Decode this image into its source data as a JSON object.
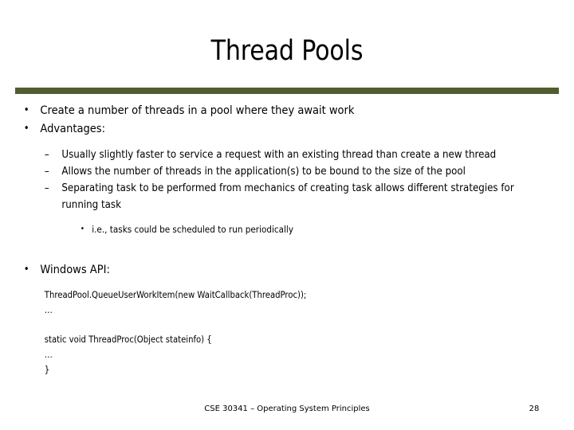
{
  "slide": {
    "title": "Thread Pools",
    "accent_color": "#4f5d2f",
    "background_color": "#ffffff",
    "text_color": "#000000"
  },
  "bullets": {
    "marker_level1": "•",
    "marker_level2": "–",
    "marker_level3": "•",
    "level1": [
      "Create a number of threads in a pool where they await work",
      "Advantages:"
    ],
    "level2": [
      "Usually slightly faster to service a request with an existing thread than create a new thread",
      "Allows the number of threads in the application(s) to be bound to the size of the pool",
      "Separating task to be performed from mechanics of creating task allows different strategies for running task"
    ],
    "level3": [
      "i.e., tasks could be scheduled to run periodically"
    ],
    "windows_api_heading": "Windows API:"
  },
  "code": {
    "line1": "ThreadPool.QueueUserWorkItem(new WaitCallback(ThreadProc));",
    "line2": "…",
    "line3": "static void ThreadProc(Object stateinfo) {",
    "line4": "…",
    "line5": "}"
  },
  "footer": {
    "course": "CSE 30341 – Operating System Principles",
    "page_number": "28"
  }
}
